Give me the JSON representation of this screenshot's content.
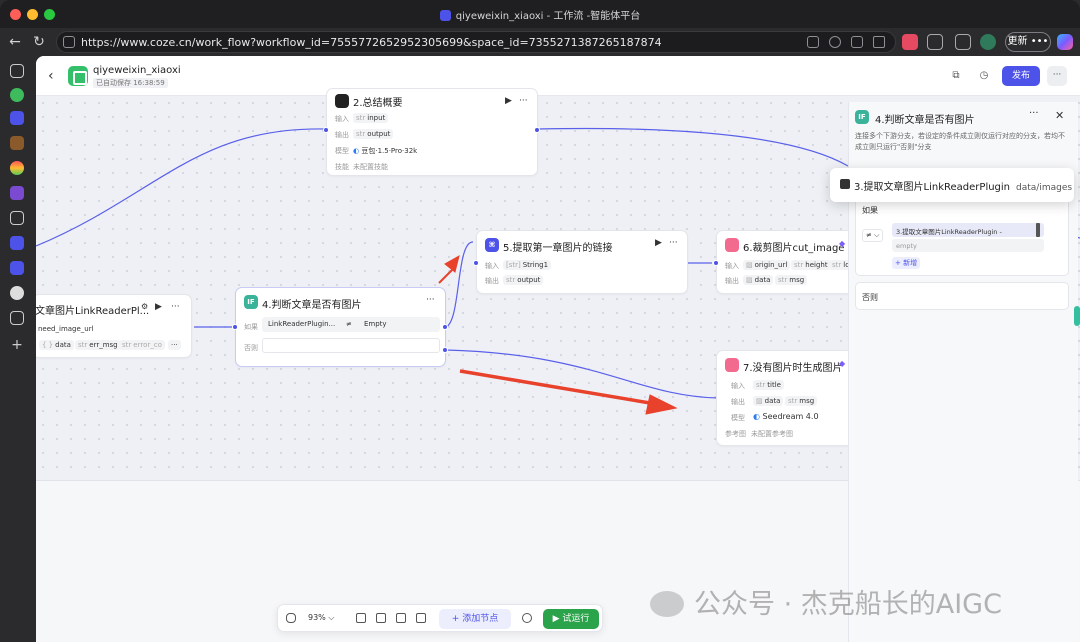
{
  "browser": {
    "window_title": "qiyeweixin_xiaoxi - 工作流 -智能体平台",
    "url": "https://www.coze.cn/work_flow?workflow_id=7555772652952305699&space_id=7355271387265187874",
    "update_label": "更新",
    "more_label": "•••"
  },
  "header": {
    "back_icon": "‹",
    "app_name": "qiyeweixin_xiaoxi",
    "autosave": "已自动保存 16:38:59",
    "publish_label": "发布",
    "more_label": "···"
  },
  "nodes": {
    "summary": {
      "title": "2.总结概要",
      "input_label": "输入",
      "input_type": "str",
      "input_value": "input",
      "output_label": "输出",
      "output_type": "str",
      "output_value": "output",
      "model_label": "模型",
      "model_value": "豆包·1.5·Pro·32k",
      "skill_label": "技能",
      "skill_value": "未配置技能"
    },
    "reader": {
      "title": "文章图片LinkReaderPl...",
      "param": "need_image_url",
      "out1": "data",
      "out2_type": "str",
      "out2": "err_msg",
      "out3_type": "str",
      "out3": "error_co",
      "more": "···"
    },
    "condition": {
      "title": "4.判断文章是否有图片",
      "icon": "IF",
      "if_label": "如果",
      "left": "LinkReaderPlugin...",
      "op": "≠",
      "right": "Empty",
      "else_label": "否则"
    },
    "extract": {
      "title": "5.提取第一章图片的链接",
      "input_label": "输入",
      "input_type": "[str]",
      "input_value": "String1",
      "output_label": "输出",
      "output_type": "str",
      "output_value": "output"
    },
    "crop": {
      "title": "6.裁剪图片cut_image",
      "input_label": "输入",
      "in1": "origin_url",
      "in2_type": "str",
      "in2": "height",
      "in3_type": "str",
      "in3": "lo",
      "output_label": "输出",
      "out1": "data",
      "out2_type": "str",
      "out2": "msg"
    },
    "gen": {
      "title": "7.没有图片时生成图片",
      "input_label": "输入",
      "input_type": "str",
      "input_value": "title",
      "output_label": "输出",
      "out1": "data",
      "out2_type": "str",
      "out2": "msg",
      "model_label": "模型",
      "model_value": "Seedream 4.0",
      "ref_label": "参考图",
      "ref_value": "未配置参考图"
    }
  },
  "panel": {
    "icon": "IF",
    "title": "4.判断文章是否有图片",
    "description": "连接多个下游分支，若设定的条件成立则仅运行对应的分支，若均不成立则只运行\"否则\"分支",
    "if_label": "如果",
    "op": "≠",
    "left_value": "3.提取文章图片LinkReaderPlugin -",
    "right_placeholder": "empty",
    "add_label": "+ 新增",
    "else_label": "否则",
    "tooltip_main": "3.提取文章图片LinkReaderPlugin",
    "tooltip_sub": "data/images"
  },
  "bottom_bar": {
    "zoom": "93%",
    "add_node": "+ 添加节点",
    "test_run": "▶ 试运行"
  },
  "watermark": "公众号 · 杰克船长的AIGC",
  "colors": {
    "accent": "#4d53e8",
    "run_green": "#2aa34a",
    "arrow_red": "#e8412c",
    "condition_teal": "#3bb39a"
  }
}
